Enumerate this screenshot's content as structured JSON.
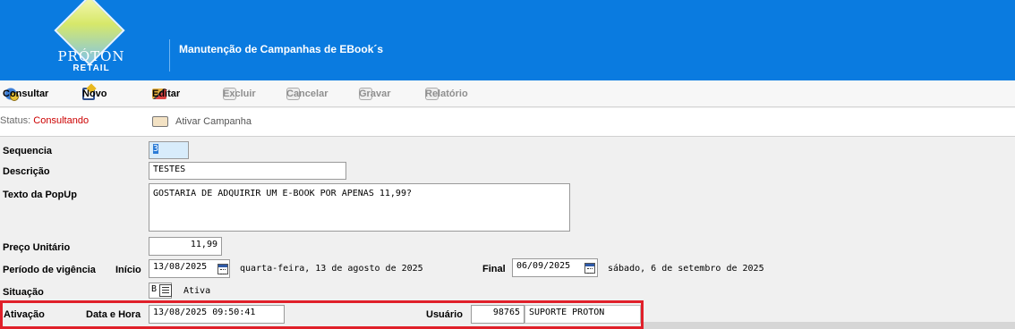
{
  "header": {
    "brand": "PRÓTON",
    "brand_sub": "RETAIL",
    "title": "Manutenção de Campanhas de EBook´s"
  },
  "toolbar": {
    "consultar": "Consultar",
    "novo": "Novo",
    "editar": "Editar",
    "excluir": "Excluir",
    "cancelar": "Cancelar",
    "gravar": "Gravar",
    "relatorio": "Relatório"
  },
  "status": {
    "label": "Status: ",
    "value": "Consultando",
    "ativar": "Ativar Campanha"
  },
  "form": {
    "sequencia_label": "Sequencia",
    "sequencia_value": "3",
    "descricao_label": "Descrição",
    "descricao_value": "TESTES",
    "texto_label": "Texto da PopUp",
    "texto_value": "GOSTARIA DE ADQUIRIR UM E-BOOK POR APENAS 11,99?",
    "preco_label": "Preço Unitário",
    "preco_value": "11,99",
    "periodo_label": "Período de vigência",
    "inicio_label": "Início",
    "inicio_value": "13/08/2025",
    "inicio_desc": "quarta-feira, 13 de agosto de 2025",
    "final_label": "Final",
    "final_value": "06/09/2025",
    "final_desc": "sábado, 6 de setembro de 2025",
    "situacao_label": "Situação",
    "situacao_code": "B",
    "situacao_desc": "Ativa",
    "ativacao_label": "Ativação",
    "datahora_label": "Data e Hora",
    "datahora_value": "13/08/2025 09:50:41",
    "usuario_label": "Usuário",
    "usuario_code": "98765",
    "usuario_name": "SUPORTE PROTON"
  },
  "colors": {
    "header_bg": "#0a7be0",
    "highlight_border": "#e0202a",
    "status_value": "#cc0000"
  }
}
